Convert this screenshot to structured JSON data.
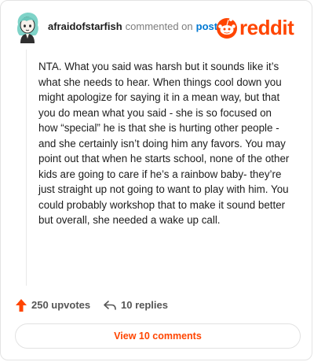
{
  "header": {
    "username": "afraidofstarfish",
    "commented_text": "commented on",
    "post_link": "post",
    "logo_text": "reddit"
  },
  "comment": {
    "body": "NTA. What you said was harsh but it sounds like it’s what she needs to hear. When things cool down you might apologize for saying it in a mean way, but that you do mean what you said - she is so focused on how “special” he is that she is hurting other people - and she certainly isn’t doing him any favors. You may point out that when he starts school, none of the other kids are going to care if he’s a rainbow baby- they’re just straight up not going to want to play with him. You could probably workshop that to make it sound better but overall, she needed a wake up call."
  },
  "actions": {
    "upvotes": "250 upvotes",
    "replies": "10 replies"
  },
  "view_button": "View 10 comments",
  "colors": {
    "brand": "#ff4500",
    "link": "#0079d3",
    "avatar_hair": "#7fd3c8"
  },
  "icons": {
    "avatar": "avatar-icon",
    "logo": "reddit-alien-icon",
    "upvote": "upvote-arrow-icon",
    "reply": "reply-arrow-icon"
  }
}
